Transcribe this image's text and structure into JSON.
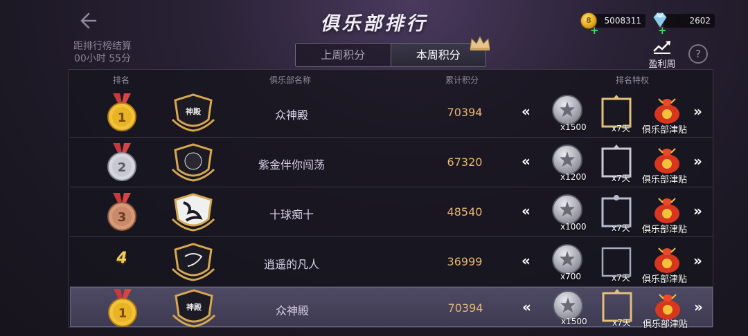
{
  "header": {
    "title": "俱乐部排行",
    "countdown_line1": "距排行榜结算",
    "countdown_line2": "00小时 55分",
    "gold": "5008311",
    "diamond": "2602",
    "profit_label": "盈利周",
    "help": "?"
  },
  "tabs": [
    {
      "label": "上周积分",
      "active": false
    },
    {
      "label": "本周积分",
      "active": true
    }
  ],
  "columns": {
    "rank": "排名",
    "club_name": "俱乐部名称",
    "score": "累计积分",
    "privilege": "排名特权"
  },
  "rows": [
    {
      "rank": "1",
      "name": "众神殿",
      "score": "70394",
      "token_count": "x1500",
      "frame_days": "x7天",
      "bag_label": "俱乐部津贴",
      "medal": "gold"
    },
    {
      "rank": "2",
      "name": "紫金伴你闯荡",
      "score": "67320",
      "token_count": "x1200",
      "frame_days": "x7天",
      "bag_label": "俱乐部津贴",
      "medal": "silver"
    },
    {
      "rank": "3",
      "name": "十球痴十",
      "score": "48540",
      "token_count": "x1000",
      "frame_days": "x7天",
      "bag_label": "俱乐部津贴",
      "medal": "bronze"
    },
    {
      "rank": "4",
      "name": "逍遥的凡人",
      "score": "36999",
      "token_count": "x700",
      "frame_days": "x7天",
      "bag_label": "俱乐部津贴",
      "medal": "none"
    }
  ],
  "my_row": {
    "rank": "1",
    "name": "众神殿",
    "score": "70394",
    "token_count": "x1500",
    "frame_days": "x7天",
    "bag_label": "俱乐部津贴",
    "medal": "gold"
  },
  "colors": {
    "gold_medal": "#e8b324",
    "silver_medal": "#c8c8d2",
    "bronze_medal": "#c88a6a",
    "score": "#e6b870",
    "highlight_row": "#4e4a64"
  },
  "icons": {
    "back": "arrow-left-icon",
    "gold": "gold-coin-icon",
    "diamond": "diamond-icon",
    "profit": "chart-up-icon",
    "help": "question-mark-icon",
    "token": "star-token-icon",
    "frame": "avatar-frame-icon",
    "bag": "money-bag-icon",
    "crown": "crown-icon"
  }
}
